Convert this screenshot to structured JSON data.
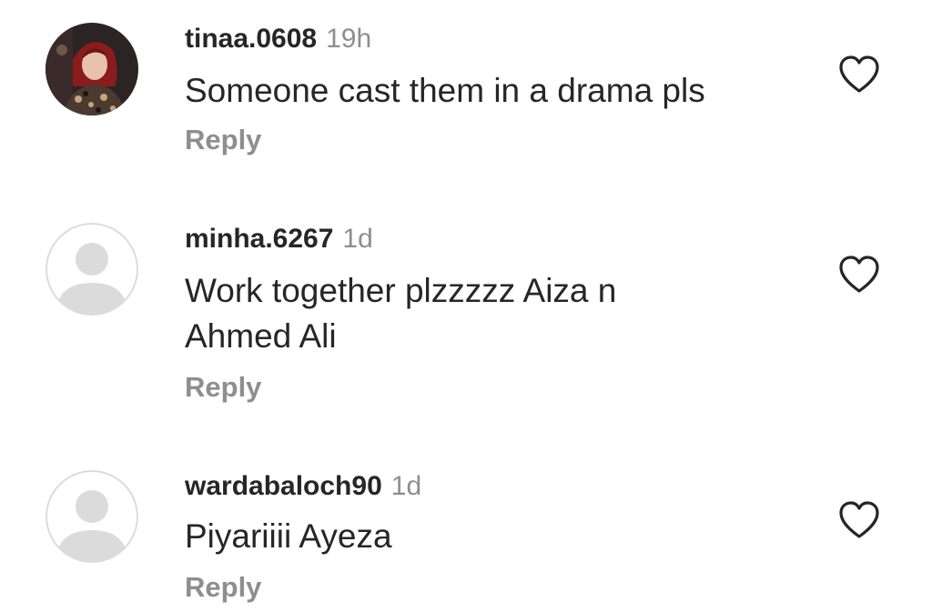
{
  "comments": [
    {
      "username": "tinaa.0608",
      "time": "19h",
      "text": "Someone cast them in a drama pls",
      "reply_label": "Reply",
      "avatar": "profile-photo",
      "like_icon": "heart-outline-icon"
    },
    {
      "username": "minha.6267",
      "time": "1d",
      "text": "Work together plzzzzz Aiza n Ahmed Ali",
      "reply_label": "Reply",
      "avatar": "default-avatar",
      "like_icon": "heart-outline-icon"
    },
    {
      "username": "wardabaloch90",
      "time": "1d",
      "text": "Piyariiii Ayeza",
      "reply_label": "Reply",
      "avatar": "default-avatar",
      "like_icon": "heart-outline-icon"
    }
  ],
  "colors": {
    "text": "#262626",
    "secondary": "#8e8e8e",
    "avatar_placeholder": "#dbdbdb"
  }
}
